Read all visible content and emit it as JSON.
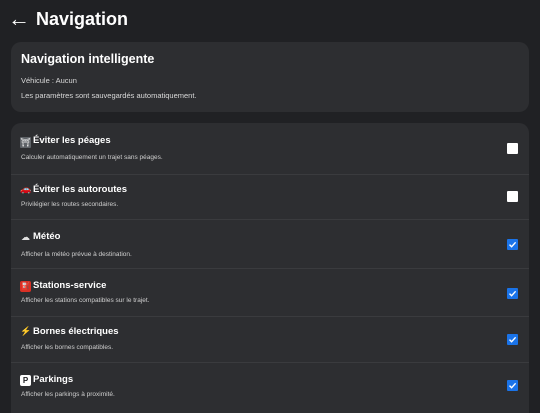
{
  "header": {
    "back_glyph": "←",
    "title": "Navigation"
  },
  "info": {
    "title": "Navigation intelligente",
    "vehicle": "Véhicule : Aucun",
    "autosave": "Les paramètres sont sauvegardés automatiquement."
  },
  "settings": [
    {
      "icon": "toll-icon",
      "glyph": "⛩",
      "title": "Éviter les péages",
      "description": "Calculer automatiquement un trajet sans péages.",
      "checked": false
    },
    {
      "icon": "car-icon",
      "glyph": "🚗",
      "title": "Éviter les autoroutes",
      "description": "Privilégier les routes secondaires.",
      "checked": false
    },
    {
      "icon": "weather-icon",
      "glyph": "☁",
      "title": "Météo",
      "description": "Afficher la météo prévue à destination.",
      "checked": true
    },
    {
      "icon": "fuel-pump-icon",
      "glyph": "⛽",
      "title": "Stations-service",
      "description": "Afficher les stations compatibles sur le trajet.",
      "checked": true
    },
    {
      "icon": "lightning-icon",
      "glyph": "⚡",
      "title": "Bornes électriques",
      "description": "Afficher les bornes compatibles.",
      "checked": true
    },
    {
      "icon": "parking-icon",
      "glyph": "P",
      "title": "Parkings",
      "description": "Afficher les parkings à proximité.",
      "checked": true
    }
  ],
  "colors": {
    "background": "#202124",
    "card": "#2d2e31",
    "checkbox_on": "#1a73e8"
  }
}
